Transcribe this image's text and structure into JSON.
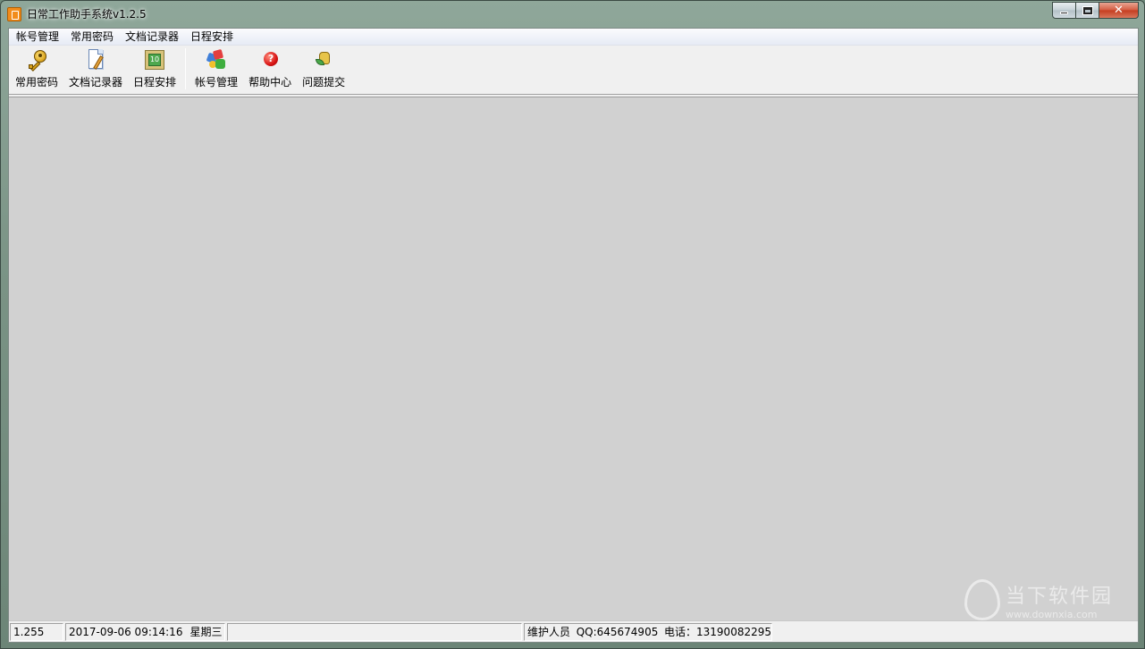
{
  "window": {
    "title": "日常工作助手系统v1.2.5"
  },
  "menubar": {
    "items": [
      "帐号管理",
      "常用密码",
      "文档记录器",
      "日程安排"
    ]
  },
  "toolbar": {
    "items": [
      {
        "label": "常用密码",
        "icon": "key-icon"
      },
      {
        "label": "文档记录器",
        "icon": "document-pen-icon"
      },
      {
        "label": "日程安排",
        "icon": "calendar-icon"
      },
      {
        "label": "帐号管理",
        "icon": "accounts-icon"
      },
      {
        "label": "帮助中心",
        "icon": "help-icon"
      },
      {
        "label": "问题提交",
        "icon": "submit-question-icon"
      }
    ],
    "calendar_glyph": "10",
    "help_glyph": "?"
  },
  "statusbar": {
    "panel1": "1.255",
    "datetime": "2017-09-06 09:14:16",
    "weekday": "星期三",
    "panel3": "",
    "maintainer": "维护人员",
    "qq": "QQ:645674905",
    "phone": "电话：13190082295"
  },
  "watermark": {
    "name": "当下软件园",
    "url": "www.downxia.com"
  },
  "colors": {
    "workspace": "#d1d1d1",
    "close_button": "#c53c1f",
    "app_icon": "#f28c1c"
  }
}
